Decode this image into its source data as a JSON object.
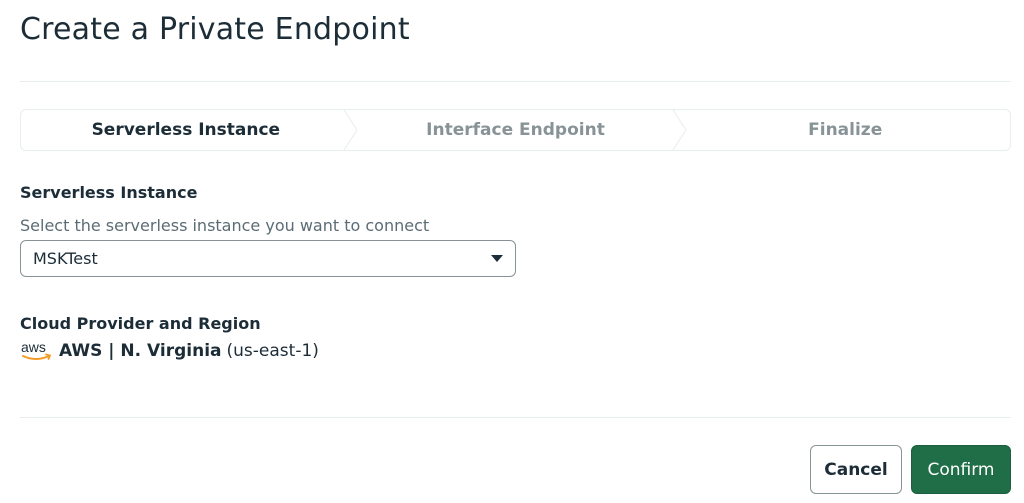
{
  "modal": {
    "title": "Create a Private Endpoint"
  },
  "wizard": {
    "steps": [
      {
        "label": "Serverless Instance",
        "state": "active"
      },
      {
        "label": "Interface Endpoint",
        "state": "inactive"
      },
      {
        "label": "Finalize",
        "state": "inactive"
      }
    ]
  },
  "serverless_instance": {
    "label": "Serverless Instance",
    "helper_text": "Select the serverless instance you want to connect",
    "selected_value": "MSKTest",
    "icon": "chevron-down-icon"
  },
  "cloud_region": {
    "label": "Cloud Provider and Region",
    "provider_logo": "aws",
    "provider_region": "AWS | N. Virginia",
    "region_code": "(us-east-1)"
  },
  "footer": {
    "cancel_label": "Cancel",
    "confirm_label": "Confirm"
  },
  "colors": {
    "primary": "#1f6e47",
    "text": "#1c2d38",
    "muted": "#889397",
    "border": "#e7eeec",
    "aws_orange": "#f49b25"
  }
}
